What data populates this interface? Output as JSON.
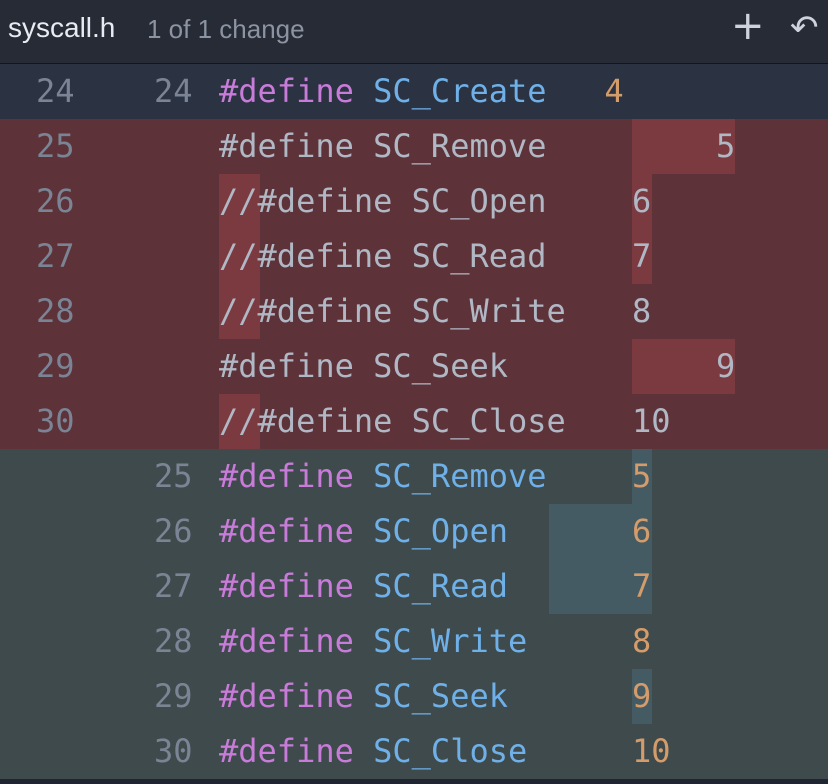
{
  "header": {
    "filename": "syscall.h",
    "change_summary": "1 of 1 change",
    "stage_icon": "plus-icon",
    "revert_icon": "revert-icon"
  },
  "diff": {
    "context": {
      "old": "24",
      "new": "24",
      "kw": "#define",
      "name": "SC_Create",
      "value": "4"
    },
    "removed": [
      {
        "old": "25",
        "text": "#define SC_Remove",
        "value": "5"
      },
      {
        "old": "26",
        "text": "//#define SC_Open",
        "value": "6"
      },
      {
        "old": "27",
        "text": "//#define SC_Read",
        "value": "7"
      },
      {
        "old": "28",
        "text": "//#define SC_Write",
        "value": "8"
      },
      {
        "old": "29",
        "text": "#define SC_Seek",
        "value": "9"
      },
      {
        "old": "30",
        "text": "//#define SC_Close",
        "value": "10"
      }
    ],
    "added": [
      {
        "new": "25",
        "kw": "#define",
        "name": "SC_Remove",
        "value": "5"
      },
      {
        "new": "26",
        "kw": "#define",
        "name": "SC_Open",
        "value": "6"
      },
      {
        "new": "27",
        "kw": "#define",
        "name": "SC_Read",
        "value": "7"
      },
      {
        "new": "28",
        "kw": "#define",
        "name": "SC_Write",
        "value": "8"
      },
      {
        "new": "29",
        "kw": "#define",
        "name": "SC_Seek",
        "value": "9"
      },
      {
        "new": "30",
        "kw": "#define",
        "name": "SC_Close",
        "value": "10"
      }
    ],
    "colors": {
      "removed_bg": "#5d3339",
      "added_bg": "#3e4a4b",
      "keyword": "#c87bd9",
      "identifier": "#6fb0e8",
      "number": "#d49c6b"
    }
  }
}
